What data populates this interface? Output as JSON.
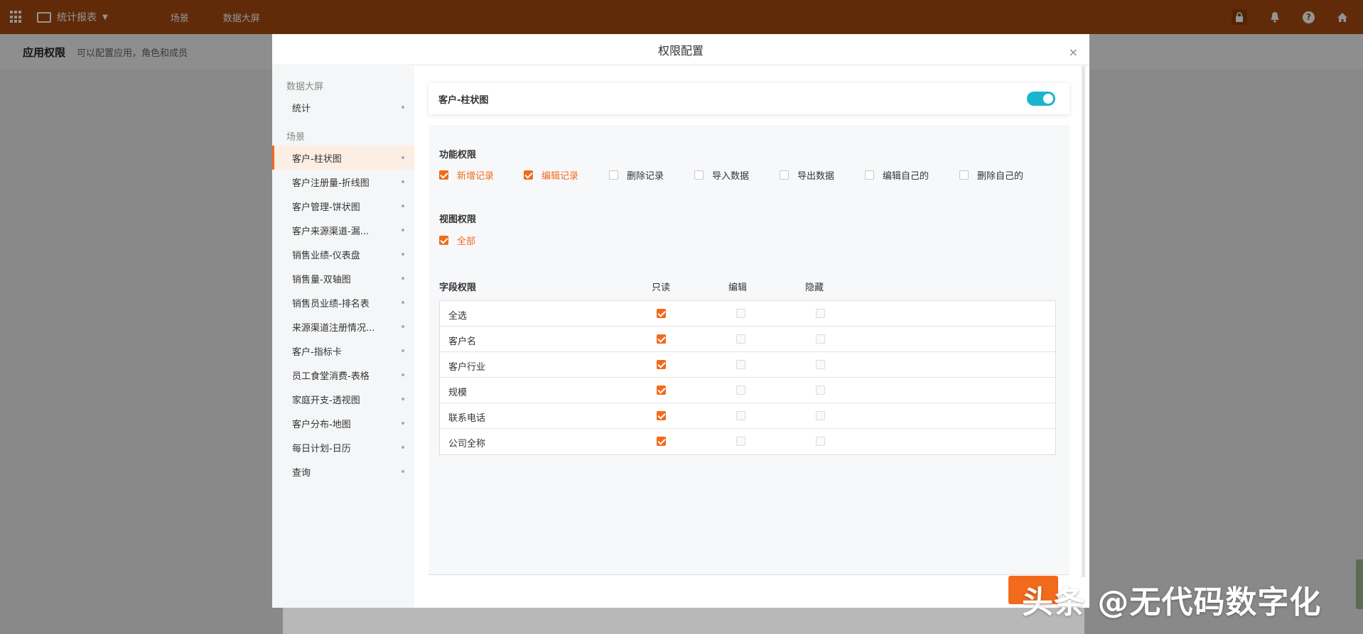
{
  "topbar": {
    "app_name": "统计报表",
    "nav": [
      "场景",
      "数据大屏"
    ],
    "icons": [
      "lock-icon",
      "bell-icon",
      "help-icon",
      "home-icon"
    ]
  },
  "subheader": {
    "title": "应用权限",
    "desc": "可以配置应用，角色和成员"
  },
  "modal": {
    "title": "权限配置",
    "close": "×",
    "sidebar": {
      "groups": [
        {
          "title": "数据大屏",
          "items": [
            "统计"
          ]
        },
        {
          "title": "场景",
          "items": [
            "客户-柱状图",
            "客户注册量-折线图",
            "客户管理-饼状图",
            "客户来源渠道-漏...",
            "销售业绩-仪表盘",
            "销售量-双轴图",
            "销售员业绩-排名表",
            "来源渠道注册情况...",
            "客户-指标卡",
            "员工食堂消费-表格",
            "家庭开支-透视图",
            "客户分布-地图",
            "每日计划-日历",
            "查询"
          ]
        }
      ],
      "active": "客户-柱状图"
    },
    "card_title": "客户-柱状图",
    "enabled": true,
    "function_perm": {
      "title": "功能权限",
      "options": [
        {
          "label": "新增记录",
          "checked": true
        },
        {
          "label": "编辑记录",
          "checked": true
        },
        {
          "label": "删除记录",
          "checked": false
        },
        {
          "label": "导入数据",
          "checked": false
        },
        {
          "label": "导出数据",
          "checked": false
        },
        {
          "label": "编辑自己的",
          "checked": false
        },
        {
          "label": "删除自己的",
          "checked": false
        }
      ]
    },
    "view_perm": {
      "title": "视图权限",
      "option": {
        "label": "全部",
        "checked": true
      }
    },
    "field_perm": {
      "title": "字段权限",
      "columns": [
        "只读",
        "编辑",
        "隐藏"
      ],
      "rows": [
        {
          "name": "全选",
          "readonly": true,
          "edit": false,
          "hide": false
        },
        {
          "name": "客户名",
          "readonly": true,
          "edit": false,
          "hide": false
        },
        {
          "name": "客户行业",
          "readonly": true,
          "edit": false,
          "hide": false
        },
        {
          "name": "规模",
          "readonly": true,
          "edit": false,
          "hide": false
        },
        {
          "name": "联系电话",
          "readonly": true,
          "edit": false,
          "hide": false
        },
        {
          "name": "公司全称",
          "readonly": true,
          "edit": false,
          "hide": false
        }
      ]
    }
  },
  "watermark": "头条 @无代码数字化"
}
